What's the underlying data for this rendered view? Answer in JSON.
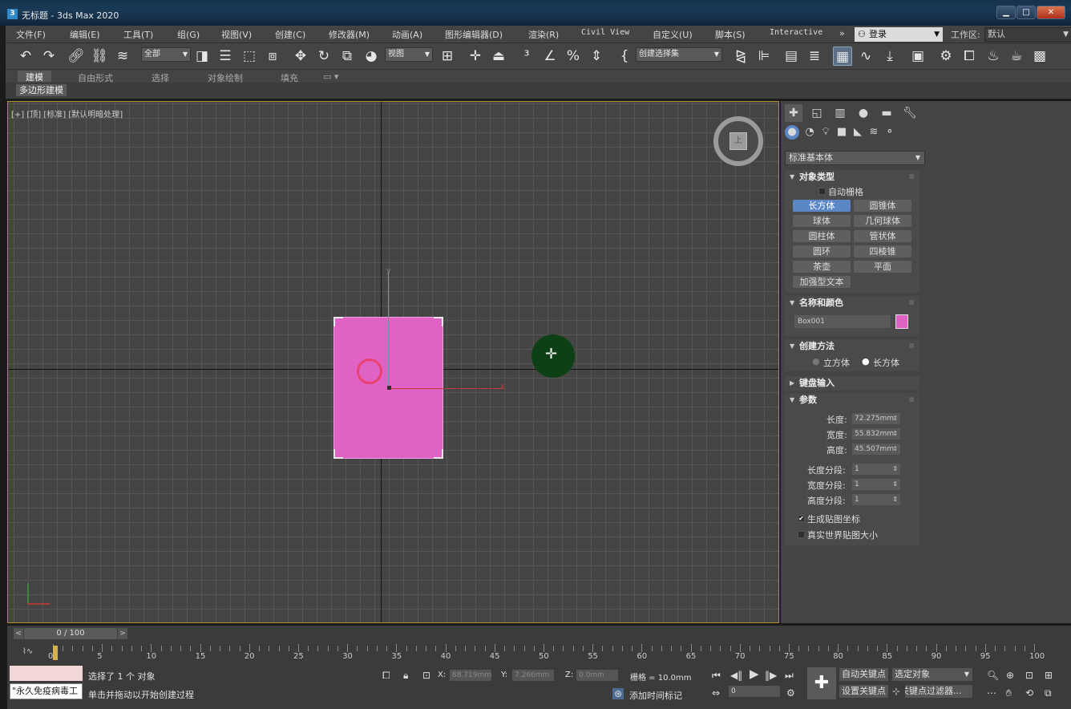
{
  "window": {
    "title": "无标题 - 3ds Max 2020",
    "app_icon": "3"
  },
  "menu": [
    "文件(F)",
    "编辑(E)",
    "工具(T)",
    "组(G)",
    "视图(V)",
    "创建(C)",
    "修改器(M)",
    "动画(A)",
    "图形编辑器(D)",
    "渲染(R)",
    "Civil View",
    "自定义(U)",
    "脚本(S)",
    "Interactive",
    "»"
  ],
  "login": {
    "label": "登录"
  },
  "workspace": {
    "label": "工作区:",
    "value": "默认"
  },
  "toolbar": {
    "selection_filter": "全部",
    "ref_coord": "视图",
    "named_selection": "创建选择集"
  },
  "ribbon": {
    "tabs": [
      "建模",
      "自由形式",
      "选择",
      "对象绘制",
      "填充"
    ],
    "active_tab": "建模",
    "sub_label": "多边形建模"
  },
  "viewport": {
    "label": "[+] [顶] [标准] [默认明暗处理]",
    "viewcube_face": "上",
    "axis_y": "y",
    "axis_x": "x"
  },
  "command_panel": {
    "category": "标准基本体",
    "object_type": {
      "title": "对象类型",
      "autogrid": "自动栅格",
      "buttons": [
        "长方体",
        "圆锥体",
        "球体",
        "几何球体",
        "圆柱体",
        "管状体",
        "圆环",
        "四棱锥",
        "茶壶",
        "平面",
        "加强型文本"
      ],
      "active": "长方体"
    },
    "name_color": {
      "title": "名称和颜色",
      "name": "Box001",
      "color": "#e062c4"
    },
    "creation_method": {
      "title": "创建方法",
      "options": [
        "立方体",
        "长方体"
      ],
      "selected": "长方体"
    },
    "keyboard_entry": {
      "title": "键盘输入"
    },
    "parameters": {
      "title": "参数",
      "length_label": "长度:",
      "length": "72.275mm",
      "width_label": "宽度:",
      "width": "55.832mm",
      "height_label": "高度:",
      "height": "45.507mm",
      "length_segs_label": "长度分段:",
      "length_segs": "1",
      "width_segs_label": "宽度分段:",
      "width_segs": "1",
      "height_segs_label": "高度分段:",
      "height_segs": "1",
      "gen_map": "生成贴图坐标",
      "real_world": "真实世界贴图大小"
    }
  },
  "timeline": {
    "frame": "0 / 100",
    "ticks": [
      "0",
      "5",
      "10",
      "15",
      "20",
      "25",
      "30",
      "35",
      "40",
      "45",
      "50",
      "55",
      "60",
      "65",
      "70",
      "75",
      "80",
      "85",
      "90",
      "95",
      "100"
    ]
  },
  "status": {
    "script_label": "\"永久免疫病毒工",
    "selected": "选择了 1 个 对象",
    "prompt": "单击并拖动以开始创建过程",
    "x_label": "X:",
    "x": "88.719mm",
    "y_label": "Y:",
    "y": "7.266mm",
    "z_label": "Z:",
    "z": "0.0mm",
    "grid": "栅格 = 10.0mm",
    "add_time_tag": "添加时间标记",
    "auto_key": "自动关键点",
    "set_key": "设置关键点",
    "selected_obj": "选定对象",
    "key_filters": "关键点过滤器...",
    "frame_field": "0"
  }
}
